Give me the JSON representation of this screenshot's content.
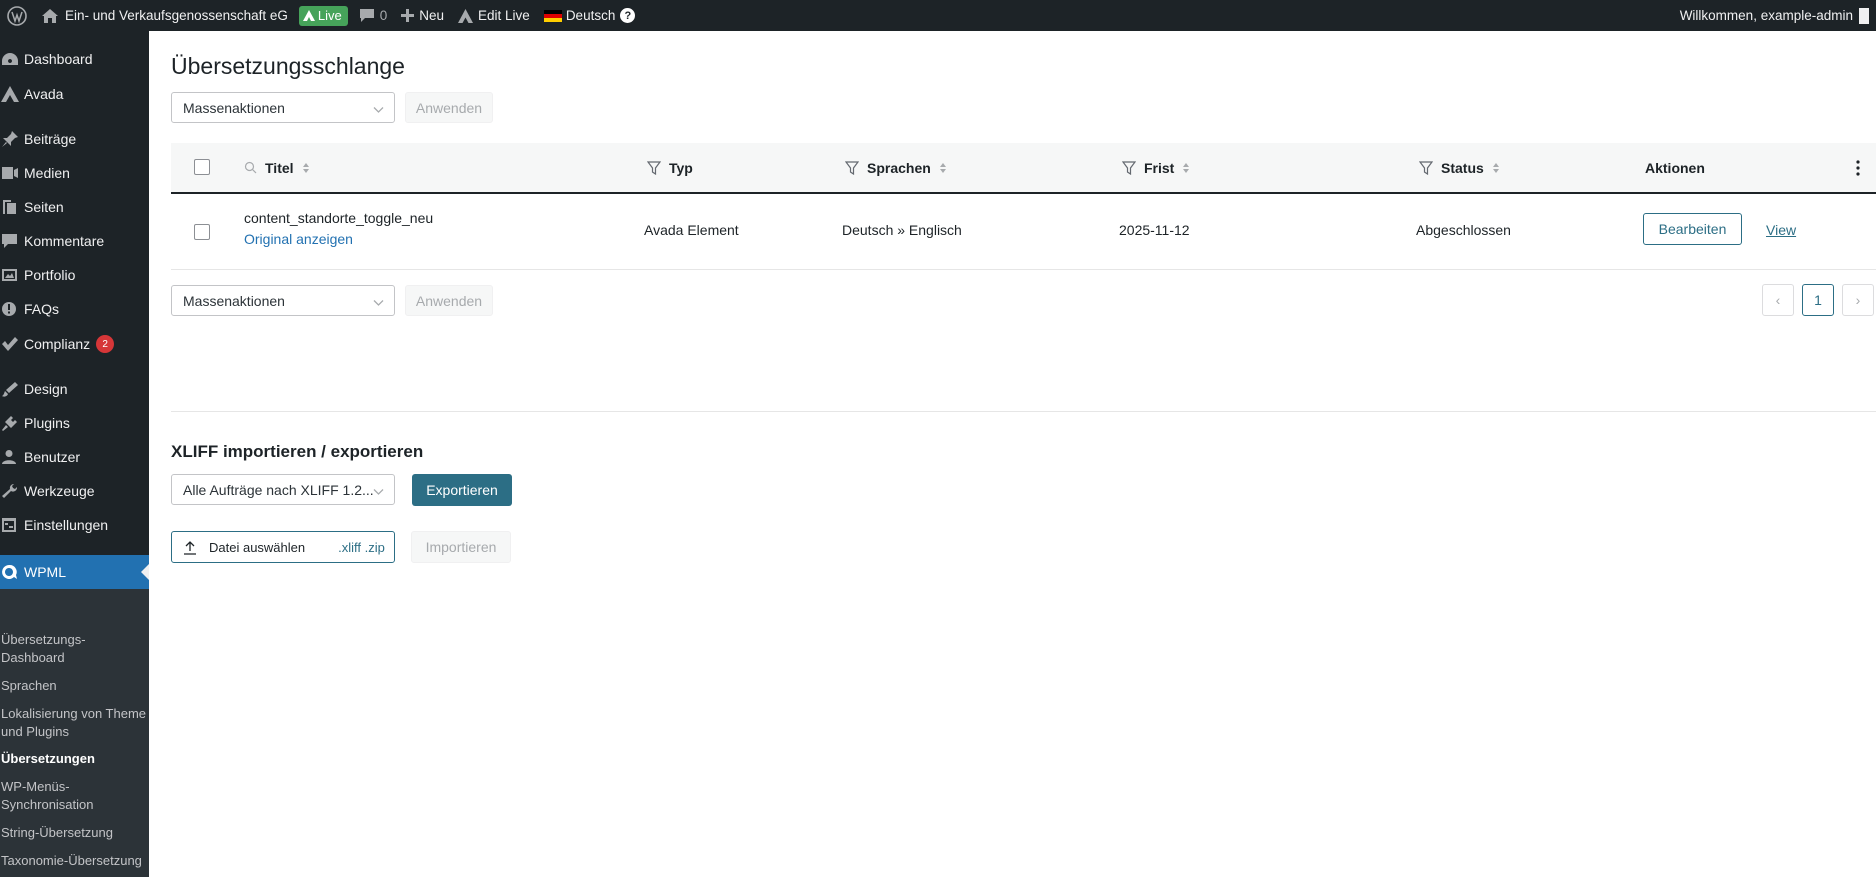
{
  "adminbar": {
    "site_name": "Ein- und Verkaufsgenossenschaft eG",
    "live_label": "Live",
    "comments_count": "0",
    "new_label": "Neu",
    "edit_live_label": "Edit Live",
    "language_label": "Deutsch",
    "help_label": "?",
    "greeting": "Willkommen, example-admin"
  },
  "sidebar": {
    "items": [
      {
        "label": "Dashboard",
        "icon": "dashboard-icon"
      },
      {
        "label": "Avada",
        "icon": "avada-icon"
      },
      {
        "label": "Beiträge",
        "icon": "pin-icon"
      },
      {
        "label": "Medien",
        "icon": "media-icon"
      },
      {
        "label": "Seiten",
        "icon": "page-icon"
      },
      {
        "label": "Kommentare",
        "icon": "comment-icon"
      },
      {
        "label": "Portfolio",
        "icon": "portfolio-icon"
      },
      {
        "label": "FAQs",
        "icon": "info-icon"
      },
      {
        "label": "Complianz",
        "icon": "check-icon",
        "badge": "2"
      },
      {
        "label": "Design",
        "icon": "brush-icon"
      },
      {
        "label": "Plugins",
        "icon": "plugin-icon"
      },
      {
        "label": "Benutzer",
        "icon": "user-icon"
      },
      {
        "label": "Werkzeuge",
        "icon": "wrench-icon"
      },
      {
        "label": "Einstellungen",
        "icon": "settings-icon"
      },
      {
        "label": "WPML",
        "icon": "wpml-icon"
      }
    ],
    "submenu": [
      "Übersetzungs-Dashboard",
      "Sprachen",
      "Lokalisierung von Theme und Plugins",
      "Übersetzungen",
      "WP-Menüs-Synchronisation",
      "String-Übersetzung",
      "Taxonomie-Übersetzung"
    ]
  },
  "main": {
    "title": "Übersetzungsschlange",
    "bulk_select": "Massenaktionen",
    "apply_label": "Anwenden",
    "columns": {
      "title": "Titel",
      "type": "Typ",
      "languages": "Sprachen",
      "deadline": "Frist",
      "status": "Status",
      "actions": "Aktionen"
    },
    "rows": [
      {
        "title": "content_standorte_toggle_neu",
        "original_link": "Original anzeigen",
        "type": "Avada Element",
        "languages": "Deutsch » Englisch",
        "deadline": "2025-11-12",
        "status": "Abgeschlossen",
        "edit_label": "Bearbeiten",
        "view_label": "View"
      }
    ],
    "pagination": {
      "current": "1",
      "prev": "‹",
      "next": "›"
    },
    "xliff": {
      "title": "XLIFF importieren / exportieren",
      "export_select": "Alle Aufträge nach XLIFF 1.2...",
      "export_label": "Exportieren",
      "file_label": "Datei auswählen",
      "file_ext": ".xliff .zip",
      "import_label": "Importieren"
    }
  }
}
